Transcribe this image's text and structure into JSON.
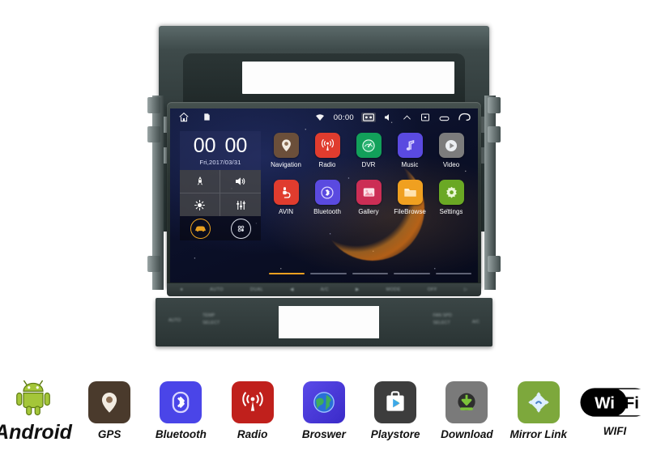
{
  "head_unit": {
    "brand_note": "car-android-head-unit",
    "screen": {
      "statusbar": {
        "left_icons": [
          {
            "name": "home-icon",
            "glyph": "home"
          },
          {
            "name": "document-icon",
            "glyph": "document"
          }
        ],
        "clock": "00:00",
        "right_icons": [
          {
            "name": "wifi-icon",
            "glyph": "wifi"
          },
          {
            "name": "screenshot-icon",
            "glyph": "screenshot",
            "highlighted": true
          },
          {
            "name": "volume-icon",
            "glyph": "speaker"
          },
          {
            "name": "eject-icon",
            "glyph": "triangle-up"
          },
          {
            "name": "screen-off-icon",
            "glyph": "box-x"
          },
          {
            "name": "recent-apps-icon",
            "glyph": "rounded-rect"
          },
          {
            "name": "back-icon",
            "glyph": "back-arrow"
          }
        ]
      },
      "clock_widget": {
        "hours": "00",
        "minutes": "00",
        "date": "Fri,2017/03/31"
      },
      "quick_toggles": [
        {
          "name": "boost-icon",
          "glyph": "rocket"
        },
        {
          "name": "volume-icon",
          "glyph": "speaker"
        },
        {
          "name": "brightness-icon",
          "glyph": "sun"
        },
        {
          "name": "equalizer-icon",
          "glyph": "sliders"
        }
      ],
      "shortcut_buttons": [
        {
          "name": "car-icon",
          "glyph": "car",
          "color": "#e8a020"
        },
        {
          "name": "all-apps-icon",
          "glyph": "apps-grid",
          "color": "#d8dce6"
        }
      ],
      "apps": [
        {
          "label": "Navigation",
          "icon": "map-pin-icon",
          "color": "#6b4f3a"
        },
        {
          "label": "Radio",
          "icon": "radio-waves-icon",
          "color": "#e03c2e"
        },
        {
          "label": "DVR",
          "icon": "dashcam-icon",
          "color": "#12a05a"
        },
        {
          "label": "Music",
          "icon": "music-note-icon",
          "color": "#5a4ae0"
        },
        {
          "label": "Video",
          "icon": "play-circle-icon",
          "color": "#7c7c7c"
        },
        {
          "label": "AVIN",
          "icon": "avin-icon",
          "color": "#e03c2e"
        },
        {
          "label": "Bluetooth",
          "icon": "bluetooth-icon",
          "color": "#5a4ae0"
        },
        {
          "label": "Gallery",
          "icon": "photo-icon",
          "color": "#cc2e55"
        },
        {
          "label": "FileBrowse",
          "icon": "folder-icon",
          "color": "#f0a020"
        },
        {
          "label": "Settings",
          "icon": "gear-icon",
          "color": "#6aa824"
        }
      ],
      "page_indicator": {
        "total": 5,
        "active": 1,
        "active_color": "#f0a020"
      }
    },
    "physical_buttons": [
      "",
      "",
      "",
      "",
      "",
      "",
      "",
      "",
      ""
    ]
  },
  "feature_strip": [
    {
      "label": "Android",
      "icon": "android-robot-icon",
      "color": "#a4c639"
    },
    {
      "label": "GPS",
      "icon": "map-pin-icon",
      "color": "#4a3a2c"
    },
    {
      "label": "Bluetooth",
      "icon": "bluetooth-icon",
      "color": "#4a45e8"
    },
    {
      "label": "Radio",
      "icon": "radio-waves-icon",
      "color": "#c0201c"
    },
    {
      "label": "Broswer",
      "icon": "globe-icon",
      "color": "#4a3ce0"
    },
    {
      "label": "Playstore",
      "icon": "playstore-bag-icon",
      "color": "#3d3d3d"
    },
    {
      "label": "Download",
      "icon": "download-arrow-icon",
      "color": "#7a7a7a"
    },
    {
      "label": "Mirror Link",
      "icon": "mirror-link-icon",
      "color": "#7da83c"
    },
    {
      "label": "WIFI",
      "icon": "wifi-logo-icon",
      "color": "#000000"
    }
  ]
}
